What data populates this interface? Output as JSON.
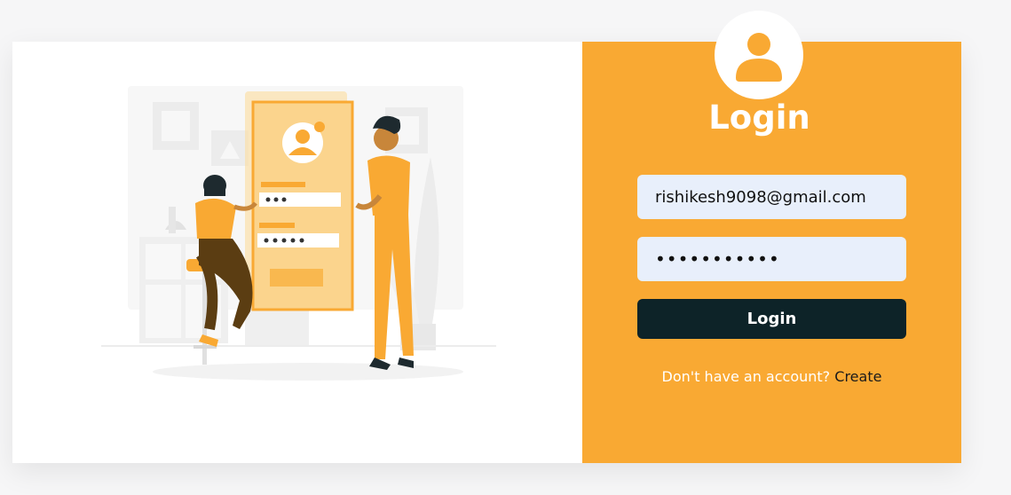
{
  "login": {
    "title": "Login",
    "email_value": "rishikesh9098@gmail.com",
    "password_value": "•••••••••••",
    "button_label": "Login",
    "signup_prompt": "Don't have an account?",
    "signup_link": "Create"
  },
  "colors": {
    "accent": "#f9a933",
    "button": "#0d2328",
    "input_bg": "#e8effb"
  }
}
